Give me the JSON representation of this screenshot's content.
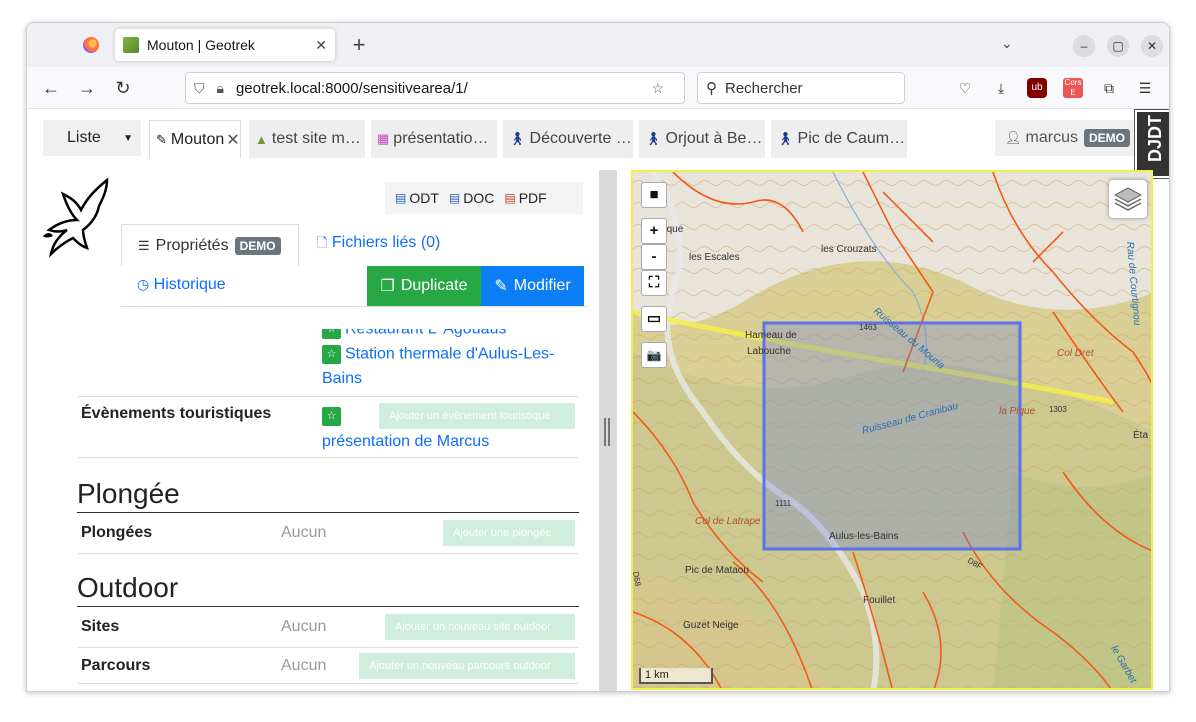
{
  "browser": {
    "tab_title": "Mouton | Geotrek",
    "url": "geotrek.local:8000/sensitivearea/1/",
    "search_placeholder": "Rechercher"
  },
  "app": {
    "list_button": "Liste",
    "tabs": [
      {
        "label": "Mouton",
        "active": true
      },
      {
        "label": "test site m…"
      },
      {
        "label": "présentatio…"
      },
      {
        "label": "Découverte …"
      },
      {
        "label": "Orjout à Be…"
      },
      {
        "label": "Pic de Caum…"
      }
    ],
    "user": "marcus",
    "user_badge": "DEMO",
    "djdt": "DJDT"
  },
  "detail": {
    "exports": [
      "ODT",
      "DOC",
      "PDF"
    ],
    "tab_properties": "Propriétés",
    "tab_properties_badge": "DEMO",
    "tab_files": "Fichiers liés (0)",
    "tab_history": "Historique",
    "btn_duplicate": "Duplicate",
    "btn_modify": "Modifier",
    "linked_items": [
      "Restaurant L' Agouaûs",
      "Station thermale d'Aulus-Les-",
      "Bains"
    ],
    "events_label": "Évènements touristiques",
    "events_add": "Ajouter un évènement touristique",
    "events_item": "présentation de Marcus",
    "sections": [
      {
        "title": "Plongée",
        "rows": [
          {
            "label": "Plongées",
            "value": "Aucun",
            "add": "Ajouter une plongée"
          }
        ]
      },
      {
        "title": "Outdoor",
        "rows": [
          {
            "label": "Sites",
            "value": "Aucun",
            "add": "Ajouter un nouveau site outdoor"
          },
          {
            "label": "Parcours",
            "value": "Aucun",
            "add": "Ajouter un nouveau parcours outdoor"
          }
        ]
      }
    ]
  },
  "map": {
    "labels": [
      "Saglaque",
      "les Escales",
      "les Crouzats",
      "Ruisseau du Mouria",
      "Hameau de Labouche",
      "Col Dret",
      "la Pique",
      "Ruisseau de Cranibau",
      "Col de Latrape",
      "Aulus-les-Bains",
      "Pic de Mataou",
      "Fouillet",
      "Guzet Neige",
      "le Garbet",
      "Rau de Courtignou",
      "Éta",
      "1463",
      "1303",
      "1111",
      "D8F",
      "D68"
    ],
    "scale": "1 km",
    "controls": [
      "■",
      "+",
      "-",
      "⛶",
      "▭",
      "📷"
    ],
    "colors": {
      "area": "#5b73e8",
      "map_border": "#f2ef4a",
      "trail": "#f25b16"
    }
  }
}
